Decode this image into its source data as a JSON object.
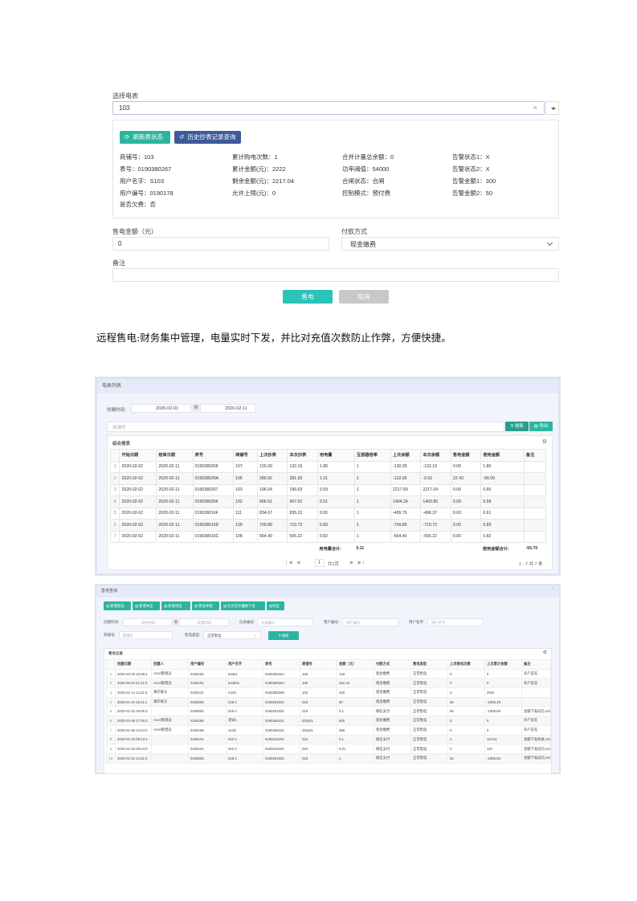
{
  "form": {
    "select_meter_label": "选择电表",
    "select_meter_value": "103",
    "clear_glyph": "×",
    "refresh_button": "刷新表状态",
    "history_button": "历史抄表记录查询",
    "info": [
      [
        "商铺号：103",
        "累计购电次数：1",
        "合并计量总余额：0",
        "告警状态1：X"
      ],
      [
        "表号：0190380267",
        "累计金额(元)：2222",
        "功率阈值：54000",
        "告警状态2：X"
      ],
      [
        "用户名字：S103",
        "剩余金额(元)：2217.04",
        "合闸状态：合闸",
        "告警金额1：300"
      ],
      [
        "用户编号：0190178",
        "允许上限(元)：0",
        "控制模式：预付费",
        "告警金额2：50"
      ],
      [
        "是否欠费：否",
        "",
        "",
        ""
      ]
    ],
    "amount_label": "售电金额（元）",
    "amount_value": "0",
    "pay_method_label": "付款方式",
    "pay_method_value": "现金缴费",
    "remark_label": "备注",
    "sell_button": "售电",
    "cancel_button": "取消"
  },
  "caption": "远程售电:财务集中管理，电量实时下发，并比对充值次数防止作弊，方便快捷。",
  "screenshot1": {
    "header": "电表列表",
    "created_label": "创建时间:",
    "date_from": "2020-02-01",
    "date_to_sep": "到",
    "date_to": "2020-02-11",
    "search_placeholder": "商铺号",
    "search_button": "搜索",
    "export_button": "导出",
    "report_title": "综合报表",
    "columns": [
      "",
      "开始日期",
      "结束日期",
      "表号",
      "商铺号",
      "上次抄表",
      "本次抄表",
      "用电量",
      "互感器倍率",
      "上次余额",
      "本次余额",
      "售电金额",
      "使用金额",
      "备注"
    ],
    "rows": [
      [
        "1",
        "2020-02-02",
        "2020-02-11",
        "0190380268",
        "107",
        "130.39",
        "132.19",
        "1.80",
        "1",
        "-130.39",
        "-132.19",
        "0.00",
        "1.80",
        ""
      ],
      [
        "2",
        "2020-02-02",
        "2020-02-11",
        "019038026A",
        "106",
        "280.92",
        "281.93",
        "1.01",
        "1",
        "-122.05",
        "-0.62",
        "22.43",
        "-99.00",
        ""
      ],
      [
        "3",
        "2020-02-02",
        "2020-02-11",
        "0190380267",
        "103",
        "196.04",
        "196.63",
        "0.59",
        "1",
        "2217.69",
        "2217.04",
        "0.00",
        "0.65",
        ""
      ],
      [
        "4",
        "2020-02-02",
        "2020-02-11",
        "0190380266",
        "102",
        "666.51",
        "667.02",
        "0.51",
        "1",
        "1404.39",
        "1403.80",
        "0.00",
        "0.59",
        ""
      ],
      [
        "5",
        "2020-02-02",
        "2020-02-11",
        "019038016F",
        "111",
        "834.67",
        "835.22",
        "0.55",
        "1",
        "-495.76",
        "-496.37",
        "0.00",
        "0.61",
        ""
      ],
      [
        "6",
        "2020-02-02",
        "2020-02-11",
        "019038016D",
        "109",
        "709.89",
        "710.72",
        "0.83",
        "1",
        "-709.89",
        "-710.72",
        "0.00",
        "0.83",
        ""
      ],
      [
        "7",
        "2020-02-02",
        "2020-02-11",
        "019038016C",
        "108",
        "564.40",
        "565.22",
        "0.82",
        "1",
        "-564.40",
        "-565.22",
        "0.00",
        "0.82",
        ""
      ]
    ],
    "total_power_label": "用电量合计:",
    "total_power": "6.11",
    "total_amount_label": "使用金额合计:",
    "total_amount": "-93.70",
    "page_input": "1",
    "page_total": "共1页",
    "record_info": "1 - 7   共 7 条"
  },
  "screenshot2": {
    "header": "售电查询",
    "toolbar": [
      "新增售电",
      "新增冲正",
      "新增退电",
      "售电冲销",
      "比对全计量数下发",
      "导出"
    ],
    "created_label": "创建时间:",
    "start_placeholder": "开始时间",
    "to_sep": "到",
    "end_placeholder": "结束时间",
    "meter_no_label": "仪表编号:",
    "meter_no_placeholder": "仪表编号",
    "user_no_label": "用户编号:",
    "user_no_placeholder": "用户编号",
    "user_name_label": "用户名字:",
    "user_name_placeholder": "用户名字",
    "shop_label": "商铺号:",
    "shop_placeholder": "商铺号",
    "type_label": "售电类型:",
    "type_value": "正常售电",
    "search_button": "搜索",
    "records_title": "售电记录",
    "columns": [
      "",
      "创建日期",
      "创建人",
      "用户编号",
      "用户名字",
      "表号",
      "商铺号",
      "金额（元）",
      "付款方式",
      "售电类型",
      "上次购电次数",
      "上次累计金额",
      "备注"
    ],
    "rows": [
      [
        "1",
        "2020-02-05 10:09:4",
        "Acrel管理员",
        "0190192",
        "test01",
        "019038026A",
        "106",
        "100",
        "现金缴费",
        "正常售电",
        "0",
        "0",
        "开户首充"
      ],
      [
        "2",
        "2020-02-04 21:21:5",
        "Acrel管理员",
        "0190191",
        "test001",
        "019038026A",
        "106",
        "322.43",
        "现金缴费",
        "正常售电",
        "0",
        "0",
        "开户首充"
      ],
      [
        "3",
        "2020-01-14 14:21:5",
        "演示账号",
        "0190131",
        "S102",
        "0190380266",
        "102",
        "100",
        "现金缴费",
        "正常售电",
        "2",
        "2001",
        ""
      ],
      [
        "4",
        "2020-01-10 15:11:1",
        "演示账号",
        "0190093",
        "018-1",
        "0190201001",
        "018",
        "80",
        "现金缴费",
        "正常售电",
        "66",
        "-1095.49",
        ""
      ],
      [
        "5",
        "2020-01-10 15:05:3",
        "",
        "0190093",
        "018-1",
        "0190201001",
        "018",
        "0.1",
        "微信支付",
        "正常售电",
        "65",
        "-1095.59",
        "金额下发成功,42000"
      ],
      [
        "6",
        "2020-01-09 17:35:3",
        "Acrel管理员",
        "0190190",
        "测试1",
        "0190460101",
        "dzby01",
        "500",
        "现金缴费",
        "正常售电",
        "0",
        "0",
        "开户首充"
      ],
      [
        "7",
        "2020-01-06 13:44:2",
        "Acrel管理员",
        "0190188",
        "ceshi",
        "0190460101",
        "dzby01",
        "355",
        "现金缴费",
        "正常售电",
        "0",
        "0",
        "开户首充"
      ],
      [
        "8",
        "2020-01-03 09:13:4",
        "",
        "0190101",
        "022-1",
        "0190242201",
        "022",
        "0.1",
        "微信支付",
        "正常售电",
        "1",
        "110.01",
        "金额下发失败,42000"
      ],
      [
        "9",
        "2020-01-03 08:24:0",
        "",
        "0190101",
        "022-1",
        "0190242201",
        "022",
        "0.01",
        "微信支付",
        "正常售电",
        "0",
        "110",
        "金额下发成功,42000"
      ],
      [
        "10",
        "2020-01-02 14:31:0",
        "",
        "0190093",
        "018-1",
        "0190201001",
        "018",
        "1",
        "微信支付",
        "正常售电",
        "64",
        "-1096.59",
        "金额下发成功,42000"
      ]
    ]
  }
}
